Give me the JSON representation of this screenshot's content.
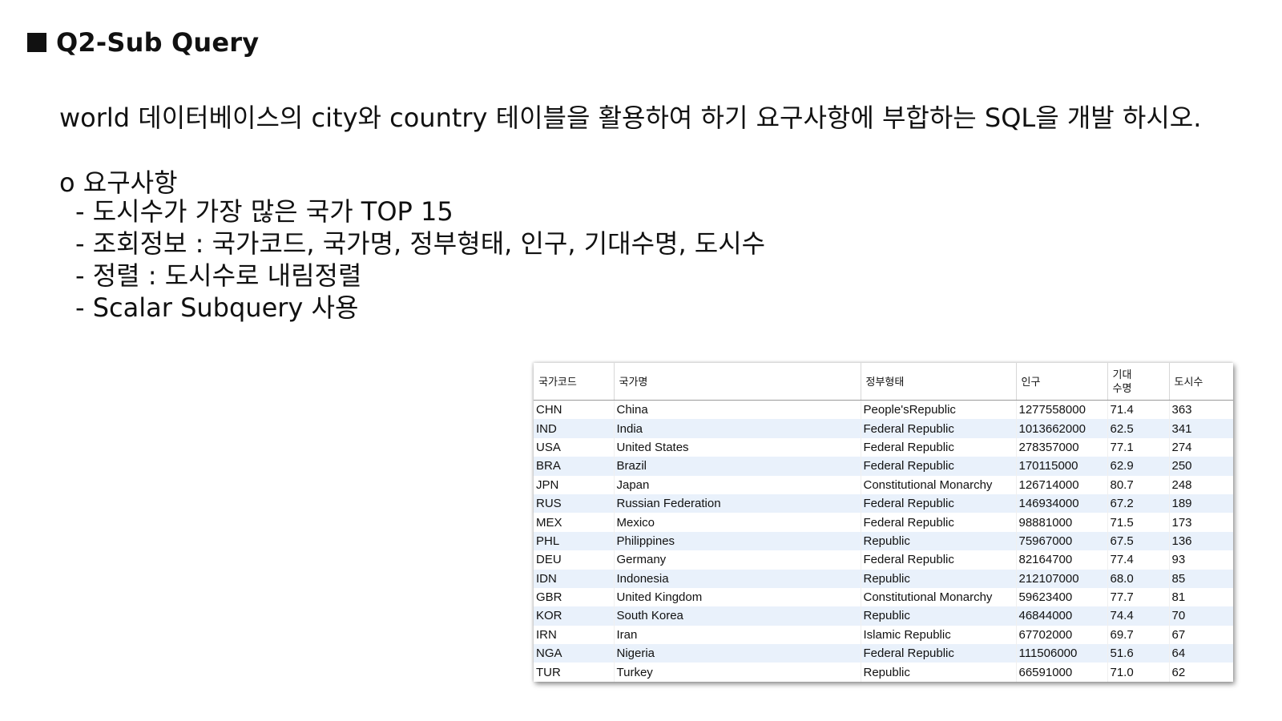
{
  "title": "Q2-Sub Query",
  "intro": "world 데이터베이스의 city와 country 테이블을 활용하여 하기 요구사항에 부합하는 SQL을 개발 하시오.",
  "requirements": {
    "heading": "o 요구사항",
    "items": [
      "- 도시수가 가장 많은 국가 TOP 15",
      "- 조회정보 : 국가코드, 국가명, 정부형태, 인구, 기대수명, 도시수",
      "- 정렬 : 도시수로 내림정렬",
      "- Scalar Subquery 사용"
    ]
  },
  "result_table": {
    "columns": [
      "국가코드",
      "국가명",
      "정부형태",
      "인구",
      "기대\n수명",
      "도시수"
    ],
    "rows": [
      [
        "CHN",
        "China",
        "People'sRepublic",
        "1277558000",
        "71.4",
        "363"
      ],
      [
        "IND",
        "India",
        "Federal Republic",
        "1013662000",
        "62.5",
        "341"
      ],
      [
        "USA",
        "United States",
        "Federal Republic",
        "278357000",
        "77.1",
        "274"
      ],
      [
        "BRA",
        "Brazil",
        "Federal Republic",
        "170115000",
        "62.9",
        "250"
      ],
      [
        "JPN",
        "Japan",
        "Constitutional Monarchy",
        "126714000",
        "80.7",
        "248"
      ],
      [
        "RUS",
        "Russian Federation",
        "Federal Republic",
        "146934000",
        "67.2",
        "189"
      ],
      [
        "MEX",
        "Mexico",
        "Federal Republic",
        "98881000",
        "71.5",
        "173"
      ],
      [
        "PHL",
        "Philippines",
        "Republic",
        "75967000",
        "67.5",
        "136"
      ],
      [
        "DEU",
        "Germany",
        "Federal Republic",
        "82164700",
        "77.4",
        "93"
      ],
      [
        "IDN",
        "Indonesia",
        "Republic",
        "212107000",
        "68.0",
        "85"
      ],
      [
        "GBR",
        "United Kingdom",
        "Constitutional Monarchy",
        "59623400",
        "77.7",
        "81"
      ],
      [
        "KOR",
        "South Korea",
        "Republic",
        "46844000",
        "74.4",
        "70"
      ],
      [
        "IRN",
        "Iran",
        "Islamic Republic",
        "67702000",
        "69.7",
        "67"
      ],
      [
        "NGA",
        "Nigeria",
        "Federal Republic",
        "111506000",
        "51.6",
        "64"
      ],
      [
        "TUR",
        "Turkey",
        "Republic",
        "66591000",
        "71.0",
        "62"
      ]
    ]
  },
  "colors": {
    "stripe": "#e9f1fb",
    "text": "#111111"
  }
}
